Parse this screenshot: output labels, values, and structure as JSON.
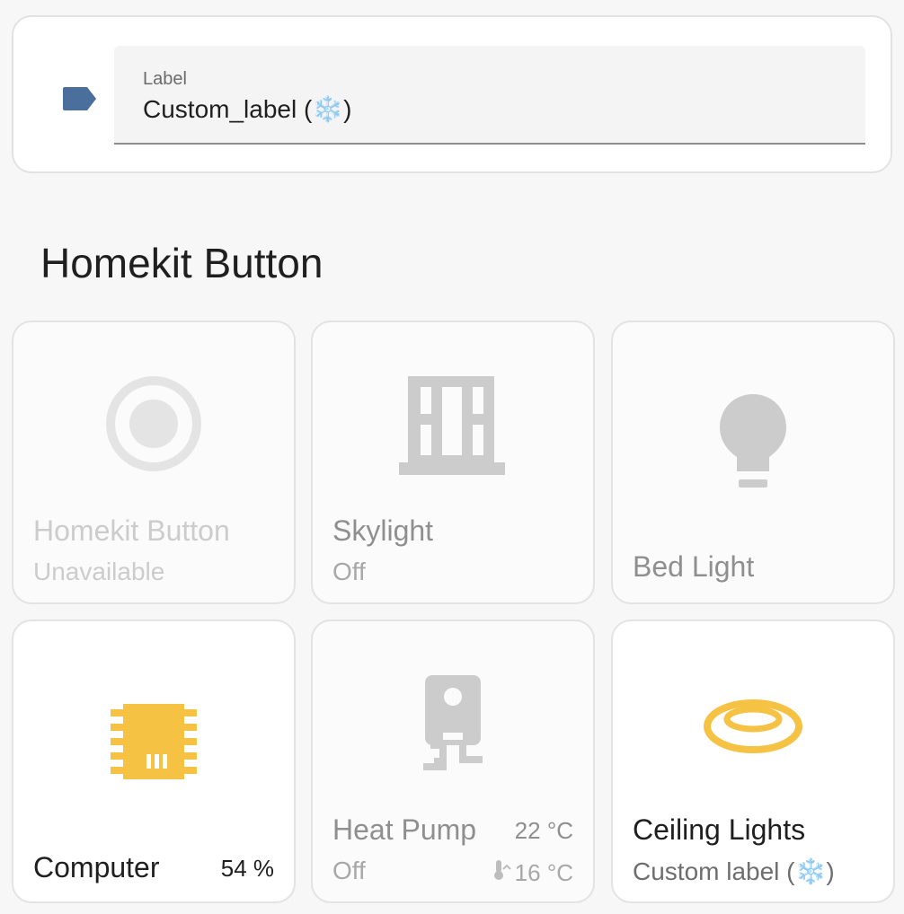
{
  "label_field": {
    "label": "Label",
    "value": "Custom_label (❄️)",
    "icon": "tag-icon"
  },
  "section": {
    "title": "Homekit Button"
  },
  "tiles": [
    {
      "name": "Homekit Button",
      "state": "Unavailable",
      "icon": "radiobox-marked-icon"
    },
    {
      "name": "Skylight",
      "state": "Off",
      "icon": "window-icon"
    },
    {
      "name": "Bed Light",
      "state": "",
      "icon": "lightbulb-icon"
    },
    {
      "name": "Computer",
      "state": "",
      "value": "54 %",
      "icon": "chip-icon"
    },
    {
      "name": "Heat Pump",
      "state": "Off",
      "value": "22 °C",
      "secondary": "16 °C",
      "icon": "heat-pump-icon"
    },
    {
      "name": "Ceiling Lights",
      "state": "Custom label (❄️)",
      "icon": "ceiling-ring-light-icon"
    }
  ],
  "colors": {
    "accent_blue": "#4a6f9c",
    "active_yellow": "#f5c243",
    "inactive_gray": "#cccccc"
  }
}
